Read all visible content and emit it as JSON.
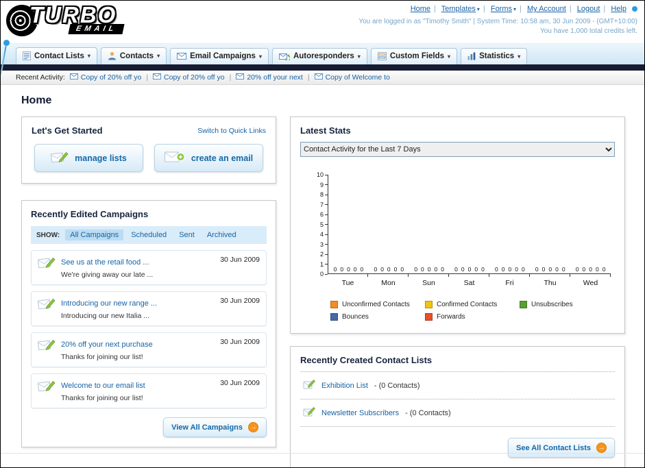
{
  "header": {
    "logo_text": "TURBO",
    "logo_sub": "EMAIL",
    "links": [
      "Home",
      "Templates",
      "Forms",
      "My Account",
      "Logout",
      "Help"
    ],
    "login_info": "You are logged in as \"Timothy Smith\" | System Time: 10:58 am, 30 Jun 2009 - (GMT+10:00)",
    "credits_info": "You have 1,000 total credits left."
  },
  "nav": {
    "tabs": [
      {
        "label": "Contact Lists"
      },
      {
        "label": "Contacts"
      },
      {
        "label": "Email Campaigns"
      },
      {
        "label": "Autoresponders"
      },
      {
        "label": "Custom Fields"
      },
      {
        "label": "Statistics"
      }
    ]
  },
  "recent_activity": {
    "label": "Recent Activity:",
    "items": [
      "Copy of 20% off yo",
      "Copy of 20% off yo",
      "20% off your next",
      "Copy of Welcome to"
    ]
  },
  "page": {
    "title": "Home"
  },
  "get_started": {
    "title": "Let's Get Started",
    "switch_link": "Switch to Quick Links",
    "buttons": [
      {
        "label": "manage lists"
      },
      {
        "label": "create an email"
      }
    ]
  },
  "campaigns": {
    "title": "Recently Edited Campaigns",
    "show_label": "SHOW:",
    "filters": [
      "All Campaigns",
      "Scheduled",
      "Sent",
      "Archived"
    ],
    "active_filter": "All Campaigns",
    "items": [
      {
        "title": "See us at the retail food ...",
        "subtitle": "We're giving away our late ...",
        "date": "30 Jun 2009"
      },
      {
        "title": "Introducing our new range ...",
        "subtitle": "Introducing our new Italia ...",
        "date": "30 Jun 2009"
      },
      {
        "title": "20% off your next purchase",
        "subtitle": "Thanks for joining our list!",
        "date": "30 Jun 2009"
      },
      {
        "title": "Welcome to our email list",
        "subtitle": "Thanks for joining our list!",
        "date": "30 Jun 2009"
      }
    ],
    "view_all_label": "View All Campaigns"
  },
  "stats": {
    "title": "Latest Stats",
    "selected_option": "Contact Activity for the Last 7 Days"
  },
  "chart_data": {
    "type": "bar",
    "title": "Contact Activity for the Last 7 Days",
    "categories": [
      "Tue",
      "Mon",
      "Sun",
      "Sat",
      "Fri",
      "Thu",
      "Wed"
    ],
    "series": [
      {
        "name": "Unconfirmed Contacts",
        "color": "#f68b1f",
        "values": [
          0,
          0,
          0,
          0,
          0,
          0,
          0
        ]
      },
      {
        "name": "Confirmed Contacts",
        "color": "#f2c40f",
        "values": [
          0,
          0,
          0,
          0,
          0,
          0,
          0
        ]
      },
      {
        "name": "Unsubscribes",
        "color": "#57a12f",
        "values": [
          0,
          0,
          0,
          0,
          0,
          0,
          0
        ]
      },
      {
        "name": "Bounces",
        "color": "#4a69a5",
        "values": [
          0,
          0,
          0,
          0,
          0,
          0,
          0
        ]
      },
      {
        "name": "Forwards",
        "color": "#e8502a",
        "values": [
          0,
          0,
          0,
          0,
          0,
          0,
          0
        ]
      }
    ],
    "ylim": [
      0,
      10
    ],
    "yticks": [
      0,
      1,
      2,
      3,
      4,
      5,
      6,
      7,
      8,
      9,
      10
    ],
    "grid": false,
    "legend_position": "bottom"
  },
  "contact_lists": {
    "title": "Recently Created Contact Lists",
    "items": [
      {
        "name": "Exhibition List",
        "detail": "- (0 Contacts)"
      },
      {
        "name": "Newsletter Subscribers",
        "detail": "- (0 Contacts)"
      }
    ],
    "see_all_label": "See All Contact Lists"
  }
}
